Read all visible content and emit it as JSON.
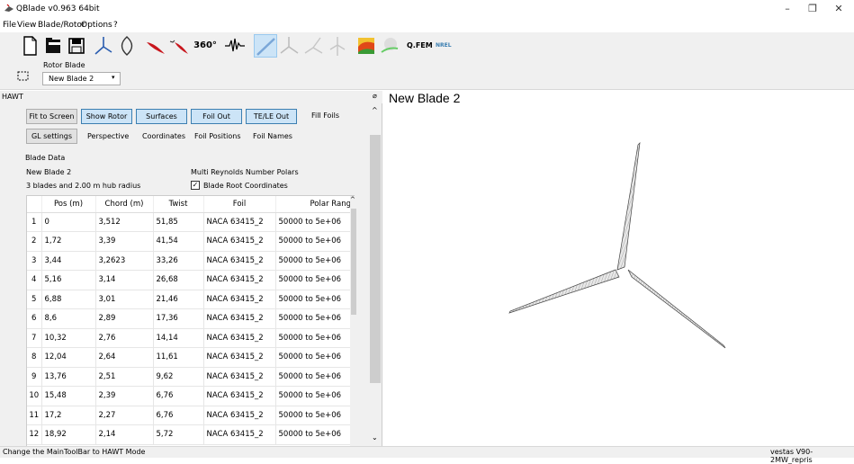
{
  "window": {
    "title": "QBlade v0.963 64bit",
    "minimize": "–",
    "maximize": "❐",
    "close": "✕"
  },
  "menu": [
    "File",
    "View",
    "Blade/Rotor",
    "Options",
    "?"
  ],
  "toolbar": {
    "text_360": "360°",
    "qfem": "Q.FEM",
    "nrel": "NREL FAST"
  },
  "rotor_select": {
    "group_label": "Rotor Blade",
    "value": "New Blade 2"
  },
  "dock": {
    "title": "HAWT"
  },
  "buttons_row1": [
    "Fit to Screen",
    "Show Rotor",
    "Surfaces",
    "Foil Out",
    "TE/LE Out",
    "Fill Foils"
  ],
  "buttons_row2": [
    "GL settings",
    "Perspective",
    "Coordinates",
    "Foil Positions",
    "Foil Names"
  ],
  "blade_data": {
    "group_label": "Blade Data",
    "name": "New Blade 2",
    "info": "3 blades and 2.00 m hub radius",
    "multi_re": "Multi Reynolds Number Polars",
    "root_coords": "Blade Root Coordinates",
    "root_checked": true
  },
  "table": {
    "headers": [
      "Pos (m)",
      "Chord (m)",
      "Twist",
      "Foil",
      "Polar Rang"
    ],
    "rows": [
      [
        "1",
        "0",
        "3,512",
        "51,85",
        "NACA 63415_2",
        "50000 to 5e+06"
      ],
      [
        "2",
        "1,72",
        "3,39",
        "41,54",
        "NACA 63415_2",
        "50000 to 5e+06"
      ],
      [
        "3",
        "3,44",
        "3,2623",
        "33,26",
        "NACA 63415_2",
        "50000 to 5e+06"
      ],
      [
        "4",
        "5,16",
        "3,14",
        "26,68",
        "NACA 63415_2",
        "50000 to 5e+06"
      ],
      [
        "5",
        "6,88",
        "3,01",
        "21,46",
        "NACA 63415_2",
        "50000 to 5e+06"
      ],
      [
        "6",
        "8,6",
        "2,89",
        "17,36",
        "NACA 63415_2",
        "50000 to 5e+06"
      ],
      [
        "7",
        "10,32",
        "2,76",
        "14,14",
        "NACA 63415_2",
        "50000 to 5e+06"
      ],
      [
        "8",
        "12,04",
        "2,64",
        "11,61",
        "NACA 63415_2",
        "50000 to 5e+06"
      ],
      [
        "9",
        "13,76",
        "2,51",
        "9,62",
        "NACA 63415_2",
        "50000 to 5e+06"
      ],
      [
        "10",
        "15,48",
        "2,39",
        "6,76",
        "NACA 63415_2",
        "50000 to 5e+06"
      ],
      [
        "11",
        "17,2",
        "2,27",
        "6,76",
        "NACA 63415_2",
        "50000 to 5e+06"
      ],
      [
        "12",
        "18,92",
        "2,14",
        "5,72",
        "NACA 63415_2",
        "50000 to 5e+06"
      ]
    ]
  },
  "view": {
    "title": "New Blade 2"
  },
  "status": {
    "left": "Change the MainToolBar to HAWT Mode",
    "right": "vestas V90-2MW_repris"
  }
}
